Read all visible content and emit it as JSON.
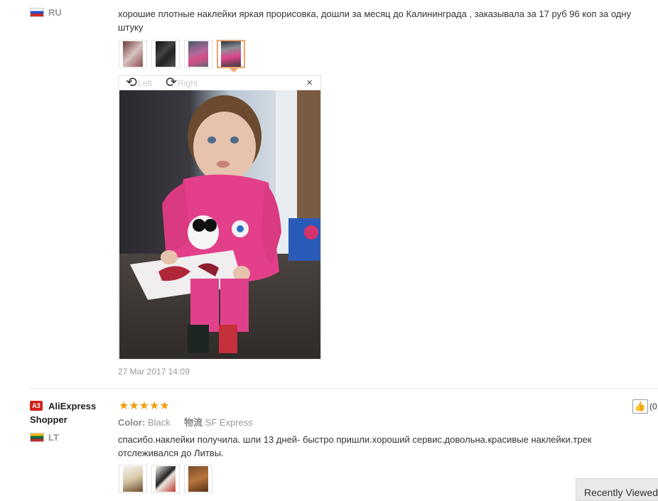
{
  "review1": {
    "country": "RU",
    "text": "хорошие плотные наклейки яркая прорисовка, дошли за месяц до Калининграда , заказывала за 17 руб 96 коп за одну штуку",
    "date": "27 Mar 2017 14:09",
    "thumbnails": [
      "photo-1",
      "photo-2",
      "photo-3",
      "photo-4"
    ],
    "viewer": {
      "rotate_left": "Left",
      "rotate_right": "Right",
      "close": "×"
    }
  },
  "review2": {
    "badge": "A3",
    "user": "AliExpress Shopper",
    "country": "LT",
    "stars": "★★★★★",
    "color_label": "Color:",
    "color_value": "Black",
    "shipping_label": "物流",
    "shipping_value": "SF Express",
    "text": "спасибо.наклейки получила. шли 13 дней- быстро пришли.хороший сервис.довольна.красивые наклейки.трек отслеживался до Литвы.",
    "helpful": "(0",
    "thumbnails": [
      "photo-1",
      "photo-2",
      "photo-3"
    ]
  },
  "recently_viewed": "Recently Viewed",
  "colors": {
    "star": "#f59c0b",
    "active_thumb_border": "#f0a36b",
    "badge": "#d0241c"
  }
}
